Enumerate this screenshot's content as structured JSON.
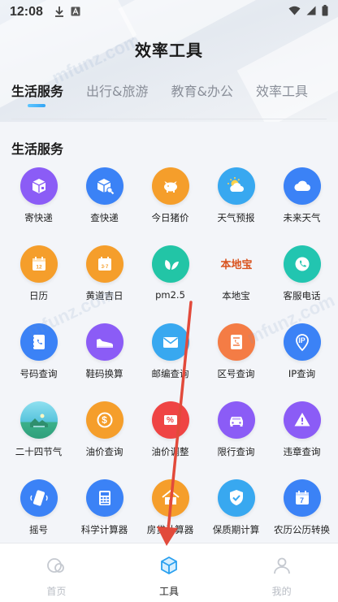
{
  "status": {
    "time": "12:08"
  },
  "page": {
    "title": "效率工具"
  },
  "tabs": [
    {
      "label": "生活服务",
      "active": true
    },
    {
      "label": "出行&旅游",
      "active": false
    },
    {
      "label": "教育&办公",
      "active": false
    },
    {
      "label": "效率工具",
      "active": false
    }
  ],
  "section": {
    "title": "生活服务"
  },
  "tools": [
    {
      "label": "寄快递",
      "icon": "package-icon",
      "color": "#8b5cf6"
    },
    {
      "label": "查快递",
      "icon": "package-search-icon",
      "color": "#3b82f6"
    },
    {
      "label": "今日猪价",
      "icon": "pig-icon",
      "color": "#f59e2b"
    },
    {
      "label": "天气预报",
      "icon": "sun-cloud-icon",
      "color": "#38a8f0"
    },
    {
      "label": "未来天气",
      "icon": "cloud-icon",
      "color": "#3b82f6"
    },
    {
      "label": "日历",
      "icon": "calendar-icon",
      "color": "#f59e2b"
    },
    {
      "label": "黄道吉日",
      "icon": "calendar-day-icon",
      "color": "#f59e2b"
    },
    {
      "label": "pm2.5",
      "icon": "leaf-icon",
      "color": "#22c5a6"
    },
    {
      "label": "本地宝",
      "icon": "bendibao-logo-icon",
      "color": "#ffffff",
      "logo_text": "本地宝"
    },
    {
      "label": "客服电话",
      "icon": "phone-icon",
      "color": "#22c5b0"
    },
    {
      "label": "号码查询",
      "icon": "phonebook-icon",
      "color": "#3b82f6"
    },
    {
      "label": "鞋码换算",
      "icon": "shoe-icon",
      "color": "#8b5cf6"
    },
    {
      "label": "邮编查询",
      "icon": "envelope-icon",
      "color": "#38a8f0"
    },
    {
      "label": "区号查询",
      "icon": "document-phone-icon",
      "color": "#f47c45"
    },
    {
      "label": "IP查询",
      "icon": "ip-pin-icon",
      "color": "#3b82f6",
      "glyph": "IP"
    },
    {
      "label": "二十四节气",
      "icon": "landscape-icon",
      "color": "#4fc3d8"
    },
    {
      "label": "油价查询",
      "icon": "dollar-icon",
      "color": "#f59e2b",
      "glyph": "$"
    },
    {
      "label": "油价调整",
      "icon": "percent-tag-icon",
      "color": "#ef4444",
      "glyph": "%"
    },
    {
      "label": "限行查询",
      "icon": "car-icon",
      "color": "#8b5cf6"
    },
    {
      "label": "违章查询",
      "icon": "warning-icon",
      "color": "#8b5cf6"
    },
    {
      "label": "摇号",
      "icon": "phone-shake-icon",
      "color": "#3b82f6"
    },
    {
      "label": "科学计算器",
      "icon": "calculator-icon",
      "color": "#3b82f6"
    },
    {
      "label": "房贷计算器",
      "icon": "house-icon",
      "color": "#f59e2b"
    },
    {
      "label": "保质期计算",
      "icon": "shield-check-icon",
      "color": "#38a8f0"
    },
    {
      "label": "农历公历转换",
      "icon": "calendar-seven-icon",
      "color": "#3b82f6",
      "glyph": "7"
    }
  ],
  "nav": [
    {
      "label": "首页",
      "icon": "home-circles-icon",
      "active": false
    },
    {
      "label": "工具",
      "icon": "cube-icon",
      "active": true
    },
    {
      "label": "我的",
      "icon": "person-icon",
      "active": false
    }
  ],
  "watermark": "mfunz.com",
  "colors": {
    "accent": "#33a5f5",
    "annotation_arrow": "#e24a3b"
  }
}
